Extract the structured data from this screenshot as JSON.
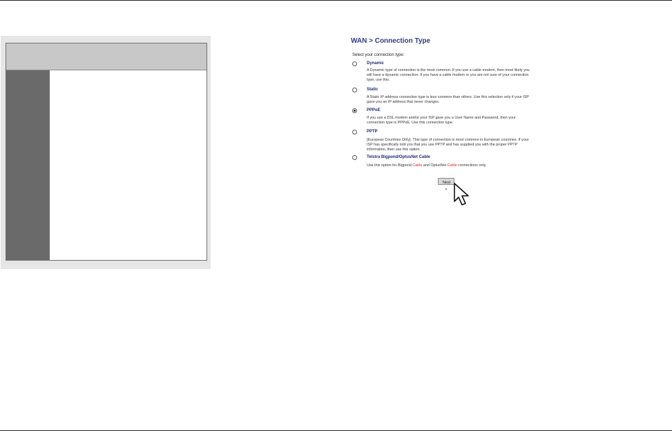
{
  "page": {
    "title": "WAN > Connection Type",
    "prompt": "Select your connection type:"
  },
  "options": [
    {
      "label": "Dynamic",
      "selected": false,
      "description": "A Dynamic type of connection is the most common. If you use a cable modem, then most likely you will have a dynamic connection. If you have a cable modem or you are not sure of your connection type, use this."
    },
    {
      "label": "Static",
      "selected": false,
      "description": "A Static IP address connection type is less common than others. Use this selection only if your ISP gave you an IP address that never changes."
    },
    {
      "label": "PPPoE",
      "selected": true,
      "description": "If you use a DSL modem and/or your ISP gave you a User Name and Password, then your connection type is PPPoE. Use this connection type."
    },
    {
      "label": "PPTP",
      "selected": false,
      "description": "[European Countries Only]. This type of connection is most common in European countries. If your ISP has specifically told you that you use PPTP and has supplied you with the proper PPTP information, then use this option."
    },
    {
      "label": "Telstra Bigpond/OptusNet Cable",
      "selected": false,
      "description_parts": [
        "Use this option for Bigpond ",
        "Cable",
        " and OptusNet ",
        "Cable",
        " connections only."
      ]
    }
  ],
  "next_button": {
    "label": "Next >"
  },
  "colors": {
    "title": "#2f3a8c",
    "highlight": "#e31e24",
    "panel_strip": "#6a6a6a"
  },
  "icons": {
    "pointer": "mouse-pointer-icon"
  }
}
